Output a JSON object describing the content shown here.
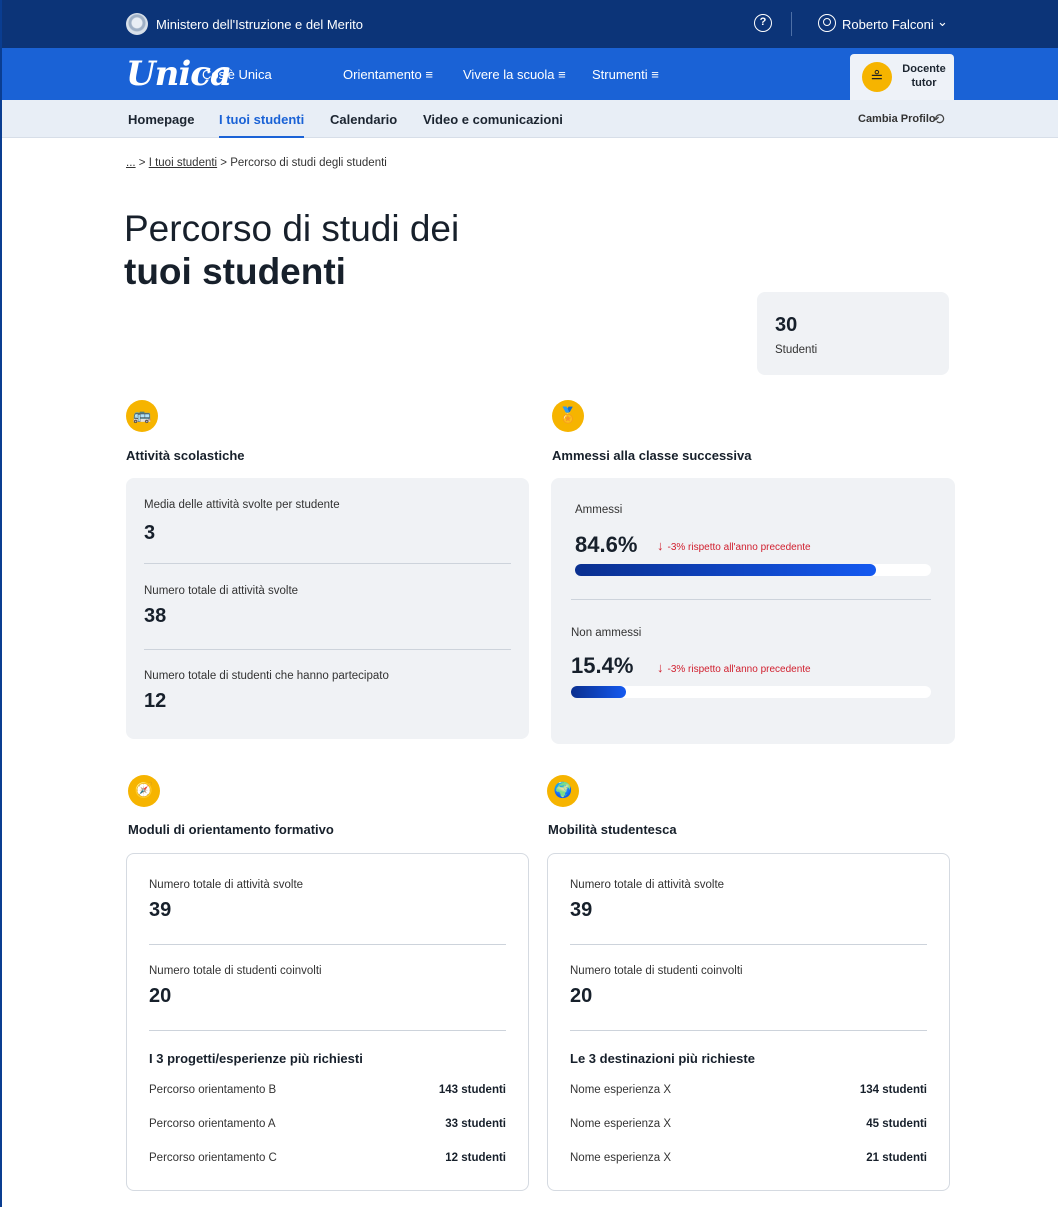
{
  "topbar": {
    "ministry": "Ministero dell'Istruzione e del Merito",
    "help_icon": "?",
    "user_name": "Roberto Falconi",
    "user_chevron": "⌄"
  },
  "mainnav": {
    "logo": "Unica",
    "items": [
      "Cos'è Unica",
      "Orientamento  ≡",
      "Vivere la scuola  ≡",
      "Strumenti  ≡"
    ],
    "profile_line1": "Docente",
    "profile_line2": "tutor"
  },
  "subnav": {
    "items": [
      "Homepage",
      "I tuoi studenti",
      "Calendario",
      "Video e comunicazioni"
    ],
    "active": "I tuoi studenti",
    "cambia_profilo": "Cambia Profilo"
  },
  "breadcrumb": {
    "ellipsis": "...",
    "sep1": " > ",
    "link": "I tuoi studenti",
    "sep2": " > ",
    "current": "Percorso di studi degli studenti"
  },
  "page": {
    "title_line1": "Percorso di studi dei",
    "title_line2": "tuoi studenti",
    "students_count": "30",
    "students_label": "Studenti"
  },
  "attivita": {
    "title": "Attività scolastiche",
    "metrics": [
      {
        "label": "Media delle attività svolte per studente",
        "value": "3"
      },
      {
        "label": "Numero totale di attività svolte",
        "value": "38"
      },
      {
        "label": "Numero totale di studenti che hanno partecipato",
        "value": "12"
      }
    ]
  },
  "ammessi": {
    "title": "Ammessi alla classe successiva",
    "rows": [
      {
        "label": "Ammessi",
        "value": "84.6%",
        "trend": "-3% rispetto all'anno precedente",
        "fraction": 0.846
      },
      {
        "label": "Non ammessi",
        "value": "15.4%",
        "trend": "-3% rispetto all'anno precedente",
        "fraction": 0.154
      }
    ],
    "trend_arrow": "↓"
  },
  "moduli": {
    "title": "Moduli di orientamento formativo",
    "metrics": [
      {
        "label": "Numero totale di attività svolte",
        "value": "39"
      },
      {
        "label": "Numero totale di studenti coinvolti",
        "value": "20"
      }
    ],
    "list_title": "I 3 progetti/esperienze più richiesti",
    "list": [
      {
        "name": "Percorso orientamento B",
        "value": "143 studenti"
      },
      {
        "name": "Percorso orientamento A",
        "value": "33 studenti"
      },
      {
        "name": "Percorso orientamento C",
        "value": "12 studenti"
      }
    ]
  },
  "mobilita": {
    "title": "Mobilità studentesca",
    "metrics": [
      {
        "label": "Numero totale di attività svolte",
        "value": "39"
      },
      {
        "label": "Numero totale di studenti coinvolti",
        "value": "20"
      }
    ],
    "list_title": "Le 3 destinazioni più richieste",
    "list": [
      {
        "name": "Nome esperienza X",
        "value": "134 studenti"
      },
      {
        "name": "Nome esperienza X",
        "value": "45 studenti"
      },
      {
        "name": "Nome esperienza X",
        "value": "21 studenti"
      }
    ]
  },
  "colors": {
    "ministry_bar": "#0c3478",
    "nav_blue": "#1a62d6",
    "accent_yellow": "#f6b400",
    "trend_red": "#d1202f"
  },
  "icons": {
    "attivita": "bus-icon",
    "ammessi": "podium-icon",
    "moduli": "compass-icon",
    "mobilita": "globe-icon"
  }
}
